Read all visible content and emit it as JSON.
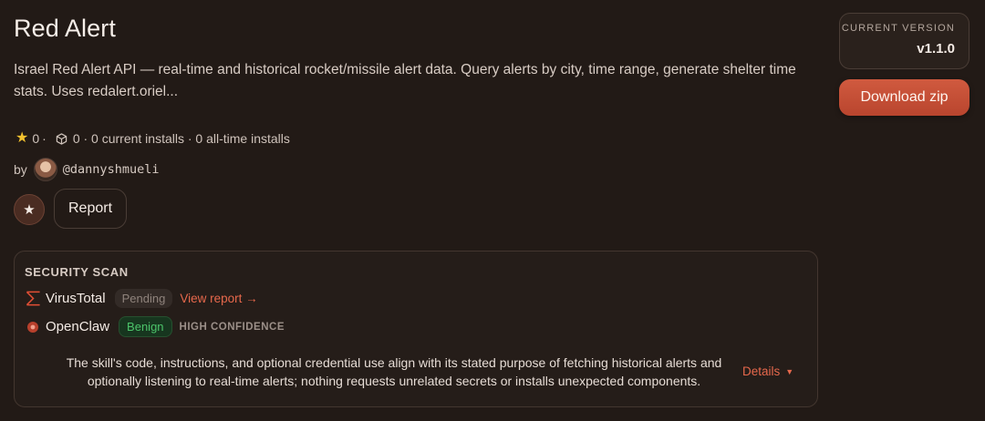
{
  "skill": {
    "title": "Red Alert",
    "description": "Israel Red Alert API — real-time and historical rocket/missile alert data. Query alerts by city, time range, generate shelter time stats. Uses redalert.oriel..."
  },
  "stats": {
    "stars": "0",
    "separator": "·",
    "installs_text": "0 · 0 current installs · 0 all-time installs"
  },
  "author": {
    "by_label": "by",
    "handle": "@dannyshmueli"
  },
  "actions": {
    "star_glyph": "★",
    "report_label": "Report"
  },
  "sidebar": {
    "version_label": "CURRENT VERSION",
    "version_value": "v1.1.0",
    "download_label": "Download zip"
  },
  "security_scan": {
    "title": "SECURITY SCAN",
    "virustotal": {
      "name": "VirusTotal",
      "status": "Pending",
      "link_label": "View report →"
    },
    "openclaw": {
      "name": "OpenClaw",
      "status": "Benign",
      "confidence": "HIGH CONFIDENCE"
    },
    "summary": "The skill's code, instructions, and optional credential use align with its stated purpose of fetching historical alerts and optionally listening to real-time alerts; nothing requests unrelated secrets or installs unexpected components.",
    "details_label": "Details",
    "details_caret": "▼"
  },
  "colors": {
    "background": "#221a16",
    "accent": "#d05a3f",
    "benign": "#4cc46a",
    "star": "#f2c12e"
  }
}
